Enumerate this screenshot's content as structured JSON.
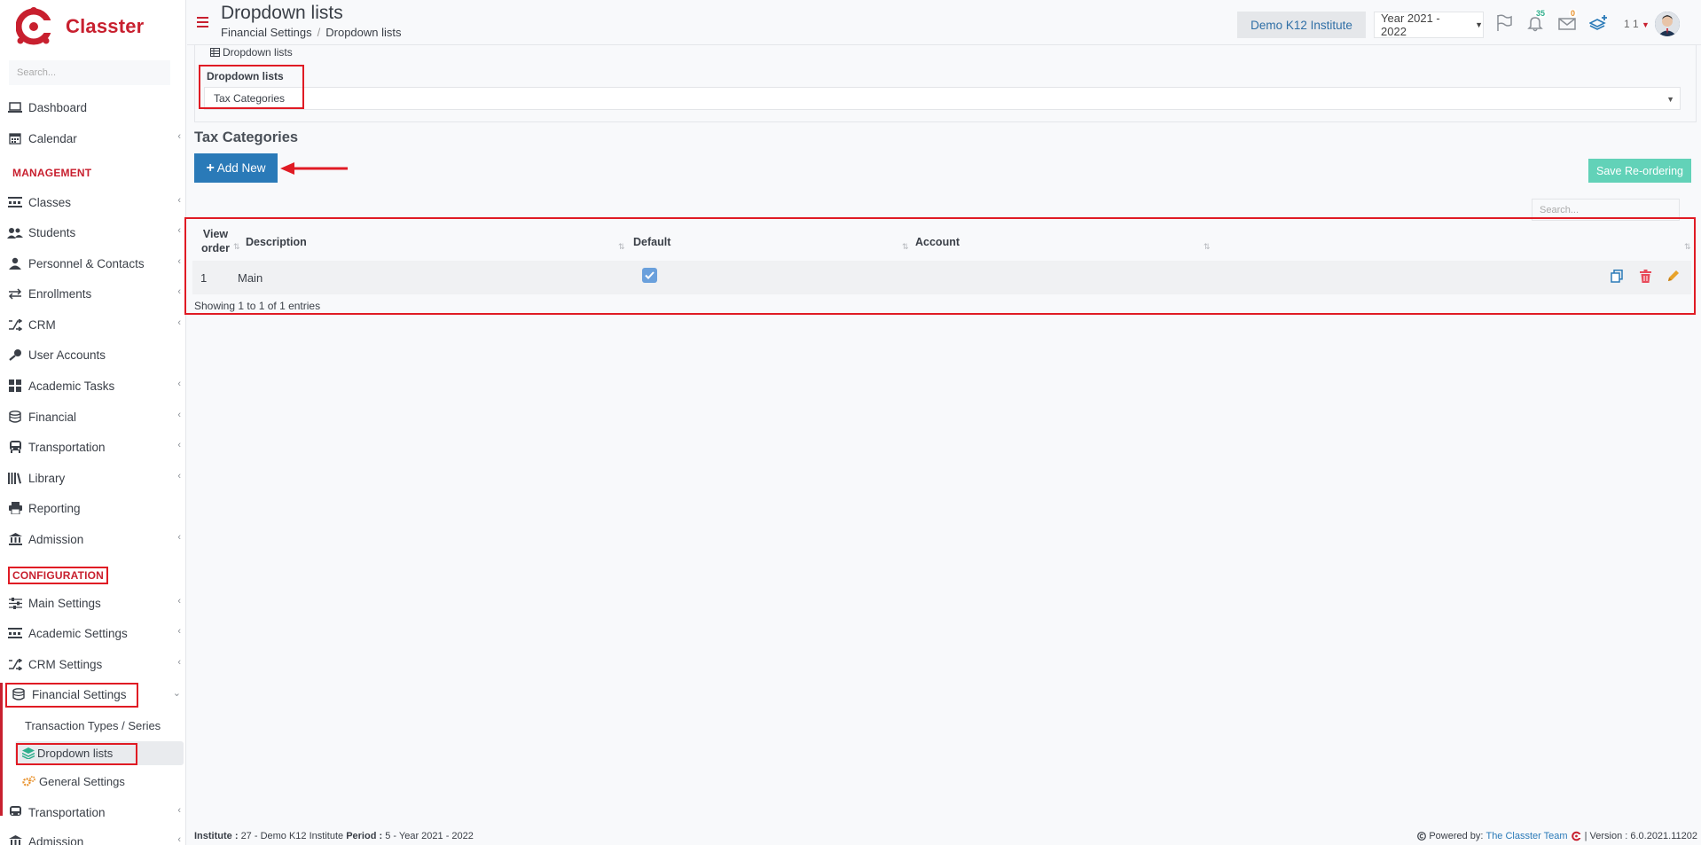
{
  "brand": {
    "name": "Classter"
  },
  "sidebar": {
    "search_placeholder": "Search...",
    "items": [
      {
        "label": "Dashboard",
        "icon": "laptop-icon"
      },
      {
        "label": "Calendar",
        "icon": "calendar-icon"
      },
      {
        "label": "Classes",
        "icon": "classes-icon"
      },
      {
        "label": "Students",
        "icon": "students-icon"
      },
      {
        "label": "Personnel & Contacts",
        "icon": "person-icon"
      },
      {
        "label": "Enrollments",
        "icon": "exchange-icon"
      },
      {
        "label": "CRM",
        "icon": "shuffle-icon"
      },
      {
        "label": "User Accounts",
        "icon": "key-icon"
      },
      {
        "label": "Academic Tasks",
        "icon": "grid-icon"
      },
      {
        "label": "Financial",
        "icon": "coins-icon"
      },
      {
        "label": "Transportation",
        "icon": "bus-icon"
      },
      {
        "label": "Library",
        "icon": "books-icon"
      },
      {
        "label": "Reporting",
        "icon": "printer-icon"
      },
      {
        "label": "Admission",
        "icon": "institution-icon"
      },
      {
        "label": "Main Settings",
        "icon": "sliders-icon"
      },
      {
        "label": "Academic Settings",
        "icon": "classes-icon"
      },
      {
        "label": "CRM Settings",
        "icon": "shuffle-icon"
      },
      {
        "label": "Financial Settings",
        "icon": "coins-icon"
      },
      {
        "label": "Transportation",
        "icon": "bus-icon"
      },
      {
        "label": "Admission",
        "icon": "institution-icon"
      }
    ],
    "sections": {
      "management": "MANAGEMENT",
      "configuration": "CONFIGURATION"
    },
    "sub_items": {
      "transaction_types": "Transaction Types / Series",
      "dropdown_lists": "Dropdown lists",
      "general_settings": "General Settings"
    }
  },
  "header": {
    "title": "Dropdown lists",
    "breadcrumb": [
      "Financial Settings",
      "Dropdown lists"
    ],
    "breadcrumb_sep": "/",
    "institute": "Demo K12 Institute",
    "year": "Year 2021 - 2022",
    "notifications_count": "35",
    "messages_count": "0",
    "user_label": "1 1"
  },
  "panel": {
    "tab_label": "Dropdown lists",
    "dropdown_label": "Dropdown lists",
    "dropdown_value": "Tax Categories"
  },
  "section": {
    "title": "Tax Categories",
    "add_button": "Add New",
    "add_plus": "+",
    "save_button": "Save Re-ordering",
    "search_placeholder": "Search..."
  },
  "table": {
    "columns": [
      "View order",
      "Description",
      "Default",
      "Account"
    ],
    "rows": [
      {
        "order": "1",
        "description": "Main",
        "default": true,
        "account": ""
      }
    ],
    "info": "Showing 1 to 1 of 1 entries"
  },
  "footer": {
    "institute_label": "Institute :",
    "institute_value": "27 - Demo K12 Institute",
    "period_label": "Period :",
    "period_value": "5 - Year 2021 - 2022",
    "powered_by": "Powered by:",
    "team": "The Classter Team",
    "version": "| Version : 6.0.2021.11202"
  },
  "colors": {
    "brand_red": "#c8202f",
    "primary_blue": "#2a7ab8",
    "teal": "#62d2b8",
    "annotation_red": "#e01b24"
  }
}
